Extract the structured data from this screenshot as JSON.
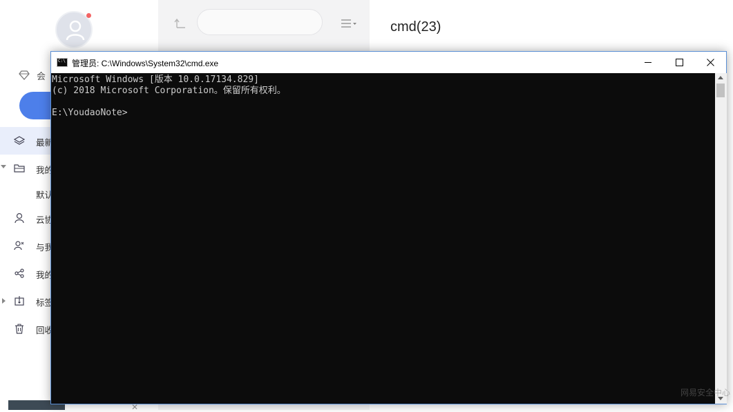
{
  "sidebar": {
    "vip_label": "会",
    "items": [
      {
        "label": "最新",
        "icon": "layers-icon",
        "active": true
      },
      {
        "label": "我的",
        "icon": "folder-icon"
      },
      {
        "label": "默认"
      },
      {
        "label": "云协",
        "icon": "person-icon"
      },
      {
        "label": "与我",
        "icon": "people-icon"
      },
      {
        "label": "我的",
        "icon": "share-icon"
      },
      {
        "label": "标签",
        "icon": "tag-icon"
      },
      {
        "label": "回收",
        "icon": "trash-icon"
      }
    ]
  },
  "document": {
    "title": "cmd(23)"
  },
  "cmd": {
    "title": "管理员: C:\\Windows\\System32\\cmd.exe",
    "icon_text": "C:\\",
    "lines": [
      "Microsoft Windows [版本 10.0.17134.829]",
      "(c) 2018 Microsoft Corporation。保留所有权利。",
      "",
      "E:\\YoudaoNote>"
    ]
  },
  "watermark": "网易安全中心"
}
